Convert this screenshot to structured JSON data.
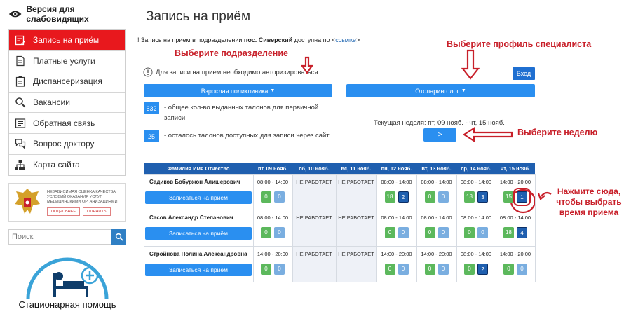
{
  "sidebar": {
    "vision_link": "Версия для слабовидящих",
    "menu": [
      {
        "label": "Запись на приём",
        "icon": "calendar-edit-icon",
        "active": true
      },
      {
        "label": "Платные услуги",
        "icon": "document-icon",
        "active": false
      },
      {
        "label": "Диспансеризация",
        "icon": "clipboard-icon",
        "active": false
      },
      {
        "label": "Вакансии",
        "icon": "magnifier-icon",
        "active": false
      },
      {
        "label": "Обратная связь",
        "icon": "feedback-form-icon",
        "active": false
      },
      {
        "label": "Вопрос доктору",
        "icon": "chat-bubbles-icon",
        "active": false
      },
      {
        "label": "Карта сайта",
        "icon": "sitemap-icon",
        "active": false
      }
    ],
    "quality_badge": {
      "title": "Независимая оценка качества условий оказания услуг медицинскими организациями",
      "more": "Подробнее",
      "rate": "Оценить"
    },
    "search_placeholder": "Поиск",
    "hospital_label": "Стационарная помощь"
  },
  "main": {
    "title": "Запись на приём",
    "notice": {
      "prefix": "! Запись на прием в подразделении ",
      "place": "пос. Сиверский",
      "middle": " доступна по <",
      "link": "ссылке",
      "suffix": ">"
    },
    "auth_note": "Для записи на прием необходимо авторизироваться.",
    "login_button": "Вход",
    "department_select": "Взрослая поликлиника",
    "profile_select": "Отоларинголог",
    "stats": [
      {
        "value": "632",
        "text": "- общее кол-во выданных талонов для первичной записи"
      },
      {
        "value": "25",
        "text": "- осталось талонов доступных для записи через сайт"
      }
    ],
    "week_label": "Текущая неделя: пт, 09 нояб. - чт, 15 нояб.",
    "next_week_button": ">"
  },
  "annotations": {
    "department": "Выберите подразделение",
    "profile": "Выберите профиль специалиста",
    "week": "Выберите неделю",
    "click": "Нажмите сюда, чтобы выбрать время приема"
  },
  "schedule": {
    "headers": [
      "Фамилия Имя Отчество",
      "пт, 09 нояб.",
      "сб, 10 нояб.",
      "вс, 11 нояб.",
      "пн, 12 нояб.",
      "вт, 13 нояб.",
      "ср, 14 нояб.",
      "чт, 15 нояб."
    ],
    "book_label": "Записаться на приём",
    "closed_label": "НЕ РАБОТАЕТ",
    "doctors": [
      {
        "name": "Садиков Бобуржон Алишерович",
        "days": [
          {
            "hours": "08:00 - 14:00",
            "slots": [
              "0",
              "0"
            ]
          },
          {
            "closed": true
          },
          {
            "closed": true
          },
          {
            "hours": "08:00 - 14:00",
            "slots": [
              "18",
              "2"
            ]
          },
          {
            "hours": "08:00 - 14:00",
            "slots": [
              "0",
              "0"
            ]
          },
          {
            "hours": "08:00 - 14:00",
            "slots": [
              "18",
              "3"
            ]
          },
          {
            "hours": "14:00 - 20:00",
            "slots": [
              "15",
              "1"
            ]
          }
        ]
      },
      {
        "name": "Сасов Александр Степанович",
        "days": [
          {
            "hours": "08:00 - 14:00",
            "slots": [
              "0",
              "0"
            ]
          },
          {
            "closed": true
          },
          {
            "closed": true
          },
          {
            "hours": "08:00 - 14:00",
            "slots": [
              "0",
              "0"
            ]
          },
          {
            "hours": "08:00 - 14:00",
            "slots": [
              "0",
              "0"
            ]
          },
          {
            "hours": "08:00 - 14:00",
            "slots": [
              "0",
              "0"
            ]
          },
          {
            "hours": "08:00 - 14:00",
            "slots": [
              "18",
              "4"
            ]
          }
        ]
      },
      {
        "name": "Стройнова Полина Александровна",
        "days": [
          {
            "hours": "14:00 - 20:00",
            "slots": [
              "0",
              "0"
            ]
          },
          {
            "closed": true
          },
          {
            "closed": true
          },
          {
            "hours": "14:00 - 20:00",
            "slots": [
              "0",
              "0"
            ]
          },
          {
            "hours": "14:00 - 20:00",
            "slots": [
              "0",
              "0"
            ]
          },
          {
            "hours": "08:00 - 14:00",
            "slots": [
              "0",
              "2"
            ]
          },
          {
            "hours": "14:00 - 20:00",
            "slots": [
              "0",
              "0"
            ]
          }
        ]
      }
    ]
  },
  "colors": {
    "accent": "#2a8ff0",
    "header": "#1f5faf",
    "active_menu": "#e8181d",
    "annotation": "#c8202a",
    "slot_green": "#5cb85c"
  }
}
